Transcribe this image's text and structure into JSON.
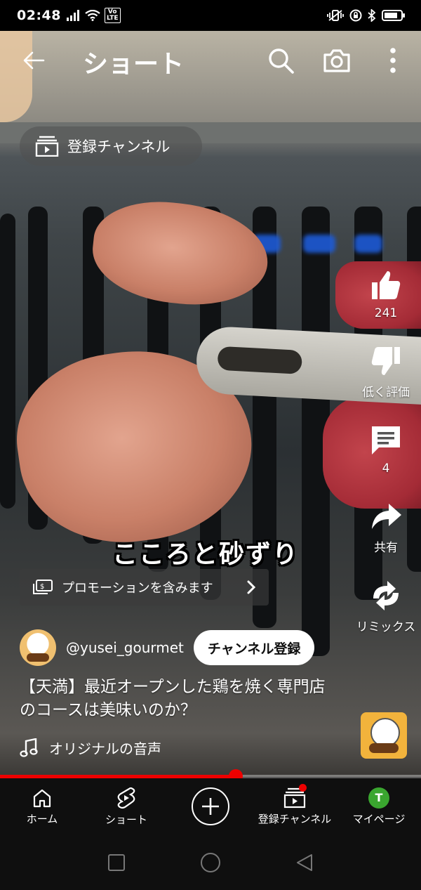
{
  "status_bar": {
    "time": "02:48",
    "volte": "Vo\nLTE",
    "icons": [
      "signal-icon",
      "wifi-icon",
      "volte-icon",
      "vibrate-icon",
      "dnd-icon",
      "bluetooth-icon",
      "battery-icon"
    ]
  },
  "header": {
    "title": "ショート",
    "icons": [
      "back-arrow-icon",
      "search-icon",
      "camera-icon",
      "more-vert-icon"
    ]
  },
  "subscriptions_chip": {
    "label": "登録チャンネル"
  },
  "video": {
    "caption": "こころと砂ずり",
    "title": "【天満】最近オープンした鶏を焼く専門店のコースは美味いのか？"
  },
  "actions": {
    "like_count": "241",
    "dislike_label": "低く評価",
    "comment_count": "4",
    "share_label": "共有",
    "remix_label": "リミックス"
  },
  "promotion": {
    "label": "プロモーションを含みます"
  },
  "channel": {
    "handle": "@yusei_gourmet",
    "subscribe_label": "チャンネル登録"
  },
  "audio": {
    "label": "オリジナルの音声"
  },
  "playback": {
    "progress": 0.56
  },
  "bottom_nav": {
    "home": "ホーム",
    "shorts": "ショート",
    "subscriptions": "登録チャンネル",
    "mypage": "マイページ",
    "mypage_initial": "T"
  },
  "colors": {
    "accent_red": "#ee0000",
    "nav_bg": "#0f0f0f",
    "avatar_green": "#3aa62f"
  }
}
